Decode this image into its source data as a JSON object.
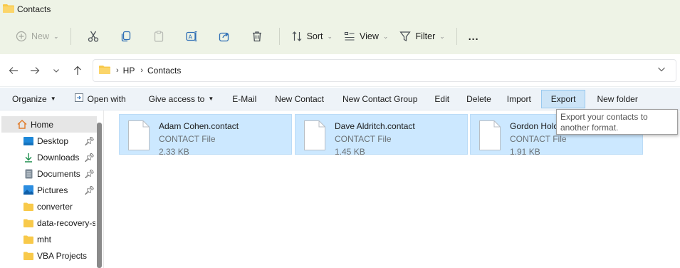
{
  "window": {
    "title": "Contacts"
  },
  "command_bar": {
    "new_label": "New",
    "sort_label": "Sort",
    "view_label": "View",
    "filter_label": "Filter",
    "more_label": "..."
  },
  "address": {
    "crumbs": [
      "HP",
      "Contacts"
    ]
  },
  "ribbon": {
    "organize": "Organize",
    "open_with": "Open with",
    "give_access": "Give access to",
    "email": "E-Mail",
    "new_contact": "New Contact",
    "new_contact_group": "New Contact Group",
    "edit": "Edit",
    "delete": "Delete",
    "import": "Import",
    "export": "Export",
    "new_folder": "New folder"
  },
  "sidebar": {
    "items": [
      {
        "label": "Home"
      },
      {
        "label": "Desktop"
      },
      {
        "label": "Downloads"
      },
      {
        "label": "Documents"
      },
      {
        "label": "Pictures"
      },
      {
        "label": "converter"
      },
      {
        "label": "data-recovery-sc"
      },
      {
        "label": "mht"
      },
      {
        "label": "VBA Projects"
      }
    ]
  },
  "files": [
    {
      "name": "Adam Cohen.contact",
      "type": "CONTACT File",
      "size": "2.33 KB"
    },
    {
      "name": "Dave Aldritch.contact",
      "type": "CONTACT File",
      "size": "1.45 KB"
    },
    {
      "name": "Gordon Holc",
      "type": "CONTACT File",
      "size": "1.91 KB"
    }
  ],
  "tooltip": {
    "text": "Export your contacts to another format."
  },
  "colors": {
    "chrome": "#eef3e6",
    "selection": "#cce8ff",
    "active_button": "#cce4f7",
    "folder": "#f8c94a"
  },
  "icons": {
    "titlebar": "folder-icon",
    "new": "plus-circle-icon",
    "cut": "scissors-icon",
    "copy": "copy-icon",
    "paste": "clipboard-icon",
    "rename": "rename-icon",
    "share": "share-icon",
    "delete": "trash-icon",
    "sort": "sort-icon",
    "view": "view-icon",
    "filter": "filter-icon"
  }
}
